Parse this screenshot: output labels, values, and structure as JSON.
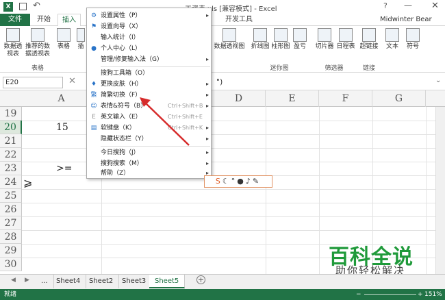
{
  "window": {
    "title": "工资表.xls  [兼容模式] - Excel",
    "user": "Midwinter Bear"
  },
  "ribbon_tabs": [
    "文件",
    "开始",
    "插入",
    "开发工具"
  ],
  "ribbon": {
    "buttons": [
      "数据透视表",
      "推荐的数据透视表",
      "表格",
      "插",
      "数据透视图",
      "折线图",
      "柱形图",
      "盈亏",
      "切片器",
      "日程表",
      "超链接",
      "文本",
      "符号"
    ],
    "groups": [
      "表格",
      "迷你图",
      "筛选器",
      "链接"
    ]
  },
  "formula_bar": {
    "name_box": "E20",
    "fx_text": "\")"
  },
  "columns": [
    "A",
    "D",
    "E",
    "F",
    "G"
  ],
  "rows": [
    "19",
    "20",
    "21",
    "22",
    "23",
    "24",
    "25",
    "26",
    "27",
    "28",
    "29",
    "30"
  ],
  "cells": {
    "r20": "15",
    "r23": ">=",
    "r24": "⩾"
  },
  "context_menu": {
    "items": [
      {
        "label": "设置属性（P）",
        "icon": "gear-icon",
        "shortcut": "",
        "submenu": true
      },
      {
        "label": "设置向导（X）",
        "icon": "flag-icon",
        "shortcut": "",
        "submenu": false
      },
      {
        "label": "输入统计（I）",
        "icon": "",
        "shortcut": "",
        "submenu": false
      },
      {
        "label": "个人中心（L）",
        "icon": "user-icon",
        "shortcut": "",
        "submenu": false
      },
      {
        "label": "管理/修复输入法（G）",
        "icon": "",
        "shortcut": "",
        "submenu": true
      },
      {
        "label": "搜狗工具箱（O）",
        "icon": "",
        "shortcut": "",
        "submenu": false
      },
      {
        "label": "更换皮肤（H）",
        "icon": "shirt-icon",
        "shortcut": "",
        "submenu": true
      },
      {
        "label": "简繁切换（F）",
        "icon": "convert-icon",
        "shortcut": "",
        "submenu": true
      },
      {
        "label": "表情&符号（B）",
        "icon": "smile-icon",
        "shortcut": "Ctrl+Shift+B",
        "submenu": true
      },
      {
        "label": "英文输入（E）",
        "icon": "",
        "shortcut": "Ctrl+Shift+E",
        "submenu": false
      },
      {
        "label": "软键盘（K）",
        "icon": "keyboard-icon",
        "shortcut": "Ctrl+Shift+K",
        "submenu": true
      },
      {
        "label": "隐藏状态栏（Y）",
        "icon": "",
        "shortcut": "",
        "submenu": true
      },
      {
        "label": "今日搜狗（J）",
        "icon": "",
        "shortcut": "",
        "submenu": true
      },
      {
        "label": "搜狗搜索（M）",
        "icon": "",
        "shortcut": "",
        "submenu": true
      },
      {
        "label": "帮助（Z）",
        "icon": "",
        "shortcut": "",
        "submenu": true
      }
    ]
  },
  "sheet_tabs": [
    "...",
    "Sheet4",
    "Sheet2",
    "Sheet3",
    "Sheet5"
  ],
  "status": {
    "left": "就绪",
    "zoom": "151%"
  },
  "watermark": {
    "main": "百科全说",
    "sub": "助你轻松解决"
  },
  "colors": {
    "excel_green": "#217346",
    "arrow_red": "#d62b2b",
    "watermark_green": "#1f9a3a"
  }
}
